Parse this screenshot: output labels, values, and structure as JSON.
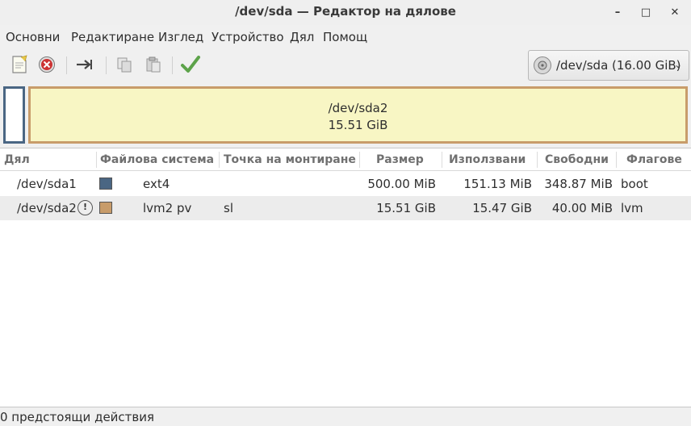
{
  "window": {
    "title": "/dev/sda — Редактор на дялове",
    "minimize_glyph": "–",
    "maximize_glyph": "□",
    "close_glyph": "✕"
  },
  "menu": [
    "Основни",
    "Редактиране",
    "Изглед",
    "Устройство",
    "Дял",
    "Помощ"
  ],
  "toolbar": {
    "icons": [
      "new-partition-icon",
      "delete-icon",
      "resize-move-icon",
      "copy-icon",
      "paste-icon",
      "apply-icon"
    ]
  },
  "device_selector": {
    "label": "/dev/sda  (16.00 GiB)",
    "icon": "disk-icon"
  },
  "partition_graphic": {
    "selected_name": "/dev/sda2",
    "selected_size": "15.51 GiB",
    "colors": {
      "sda1": "#4a6683",
      "sda2": "#c89c6a",
      "fill": "#f8f6c4"
    }
  },
  "table": {
    "headers": [
      "Дял",
      "Файлова система",
      "Точка на монтиране",
      "Размер",
      "Използвани",
      "Свободни",
      "Флагове"
    ],
    "rows": [
      {
        "partition": "/dev/sda1",
        "fs_color": "#4a6683",
        "filesystem": "ext4",
        "mountpoint": "",
        "size": "500.00 MiB",
        "used": "151.13 MiB",
        "free": "348.87 MiB",
        "flags": "boot",
        "locked": false
      },
      {
        "partition": "/dev/sda2",
        "fs_color": "#c89c6a",
        "filesystem": "lvm2 pv",
        "mountpoint": "sl",
        "size": "15.51 GiB",
        "used": "15.47 GiB",
        "free": "40.00 MiB",
        "flags": "lvm",
        "locked": true
      }
    ]
  },
  "status": "0 предстоящи действия"
}
